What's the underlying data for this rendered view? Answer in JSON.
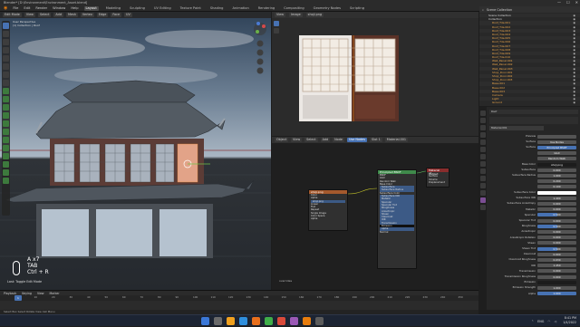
{
  "window": {
    "title": "Blender* [D:\\Environment\\Environment_Asset.blend]",
    "controls": [
      "—",
      "☐",
      "✕"
    ]
  },
  "menubar": {
    "menus": [
      "File",
      "Edit",
      "Render",
      "Window",
      "Help"
    ],
    "workspaces": [
      "Layout",
      "Modeling",
      "Sculpting",
      "UV Editing",
      "Texture Paint",
      "Shading",
      "Animation",
      "Rendering",
      "Compositing",
      "Geometry Nodes",
      "Scripting"
    ],
    "active_workspace": "Layout"
  },
  "viewport": {
    "header_items": [
      "Edit Mode",
      "View",
      "Select",
      "Add",
      "Mesh",
      "Vertex",
      "Edge",
      "Face",
      "UV"
    ],
    "info_lines": [
      "User Perspective",
      "(1) Collection | Roof"
    ],
    "key_overlay": [
      "A x7",
      "TAB",
      "Ctrl + R"
    ],
    "last_op": "Last: Toggle Edit Mode",
    "colors": {
      "sky_top": "#2e4157",
      "sky_mid": "#6c7f93",
      "horizon": "#a9b6c3",
      "ground": "#2f3338"
    }
  },
  "image_editor": {
    "header_items": [
      "View",
      "Image",
      "shoji.png"
    ],
    "texture_name": "shoji.png"
  },
  "node_editor": {
    "header_items": [
      "Object",
      "View",
      "Select",
      "Add",
      "Node",
      "Use Nodes",
      "Slot 1",
      "Material.001"
    ],
    "label": "overrides",
    "image_node": {
      "title": "shoji.png",
      "rows": [
        "Color",
        "Alpha",
        "shoji.png",
        "Linear",
        "Flat",
        "Repeat",
        "Single Image",
        "Color Space",
        "Alpha"
      ]
    },
    "bsdf_node": {
      "title": "Principled BSDF",
      "rows": [
        "BSDF",
        "GGX",
        "Random Walk",
        "Base Color",
        "Subsurface",
        "Subsurface Radius",
        "Subsurface Color",
        "Subsurface IOR",
        "Metallic",
        "Specular",
        "Specular Tint",
        "Roughness",
        "Anisotropic",
        "Sheen",
        "Clearcoat",
        "IOR",
        "Transmission",
        "Emission",
        "Alpha",
        "Normal"
      ]
    },
    "output_node": {
      "title": "Material Output",
      "rows": [
        "All",
        "Surface",
        "Volume",
        "Displacement"
      ]
    }
  },
  "outliner": {
    "header": "Scene Collection",
    "rows": [
      "Scene Collection",
      "Collection",
      "Roof_Tile.001",
      "Roof_Tile.002",
      "Roof_Tile.003",
      "Roof_Tile.004",
      "Roof_Tile.005",
      "Roof_Tile.006",
      "Roof_Tile.007",
      "Roof_Tile.008",
      "Roof_Tile.009",
      "Roof_Tile.010",
      "Wall_Panel.001",
      "Wall_Panel.002",
      "Wall_Panel.003",
      "Shoji_Door.001",
      "Shoji_Door.002",
      "Shoji_Door.003",
      "Base.001",
      "Base.002",
      "Base.003",
      "Camera",
      "Light",
      "Ground"
    ]
  },
  "properties": {
    "object_name": "Roof",
    "material": "Material.001",
    "section_surface": "Surface",
    "surface_value": "Principled BSDF",
    "rows": [
      {
        "label": "Preview",
        "value": ""
      },
      {
        "label": "Surface",
        "value": "Use Nodes"
      },
      {
        "label": "Surface",
        "value": "Principled BSDF",
        "style": "sel"
      },
      {
        "label": "",
        "value": "GGX"
      },
      {
        "label": "",
        "value": "Random Walk"
      },
      {
        "label": "Base Color",
        "value": "shoji.png",
        "style": "dark"
      },
      {
        "label": "Subsurface",
        "value": "0.000"
      },
      {
        "label": "Subsurface Radius",
        "value": "1.000"
      },
      {
        "label": "",
        "value": "0.200"
      },
      {
        "label": "",
        "value": "0.100"
      },
      {
        "label": "Subsurface Color",
        "value": "",
        "style": "white"
      },
      {
        "label": "Subsurface IOR",
        "value": "1.400"
      },
      {
        "label": "Subsurface Anisotropy",
        "value": "0.000"
      },
      {
        "label": "Metallic",
        "value": "0.000"
      },
      {
        "label": "Specular",
        "value": "0.500",
        "fill": 0.5
      },
      {
        "label": "Specular Tint",
        "value": "0.000"
      },
      {
        "label": "Roughness",
        "value": "0.500",
        "fill": 0.5
      },
      {
        "label": "Anisotropic",
        "value": "0.000"
      },
      {
        "label": "Anisotropic Rotation",
        "value": "0.000"
      },
      {
        "label": "Sheen",
        "value": "0.000"
      },
      {
        "label": "Sheen Tint",
        "value": "0.500",
        "fill": 0.5
      },
      {
        "label": "Clearcoat",
        "value": "0.000"
      },
      {
        "label": "Clearcoat Roughness",
        "value": "0.030"
      },
      {
        "label": "IOR",
        "value": "1.450"
      },
      {
        "label": "Transmission",
        "value": "0.000"
      },
      {
        "label": "Transmission Roughness",
        "value": "0.000"
      },
      {
        "label": "Emission",
        "value": "",
        "style": "dark"
      },
      {
        "label": "Emission Strength",
        "value": "1.000"
      },
      {
        "label": "Alpha",
        "value": "1.000",
        "fill": 1.0
      }
    ]
  },
  "timeline": {
    "menu": [
      "Playback",
      "Keying",
      "View",
      "Marker"
    ],
    "current_frame": "1",
    "ticks": [
      "0",
      "10",
      "20",
      "30",
      "40",
      "50",
      "60",
      "70",
      "80",
      "90",
      "100",
      "110",
      "120",
      "130",
      "140",
      "150",
      "160",
      "170",
      "180",
      "190",
      "200",
      "210",
      "220",
      "230",
      "240",
      "250"
    ]
  },
  "statusbar": {
    "text": "Select   Box Select   Rotate View   Call Menu"
  },
  "taskbar": {
    "tray": [
      "ENG",
      "⌃"
    ],
    "time": "8:41 PM",
    "date": "1/4/2022",
    "icon_colors": [
      "#3b78d8",
      "#6a6a6a",
      "#f0a11f",
      "#2f8fdd",
      "#e86f1c",
      "#3fae49",
      "#d94a3a",
      "#9b59b6",
      "#e87d0d",
      "#5c5c5c"
    ]
  }
}
